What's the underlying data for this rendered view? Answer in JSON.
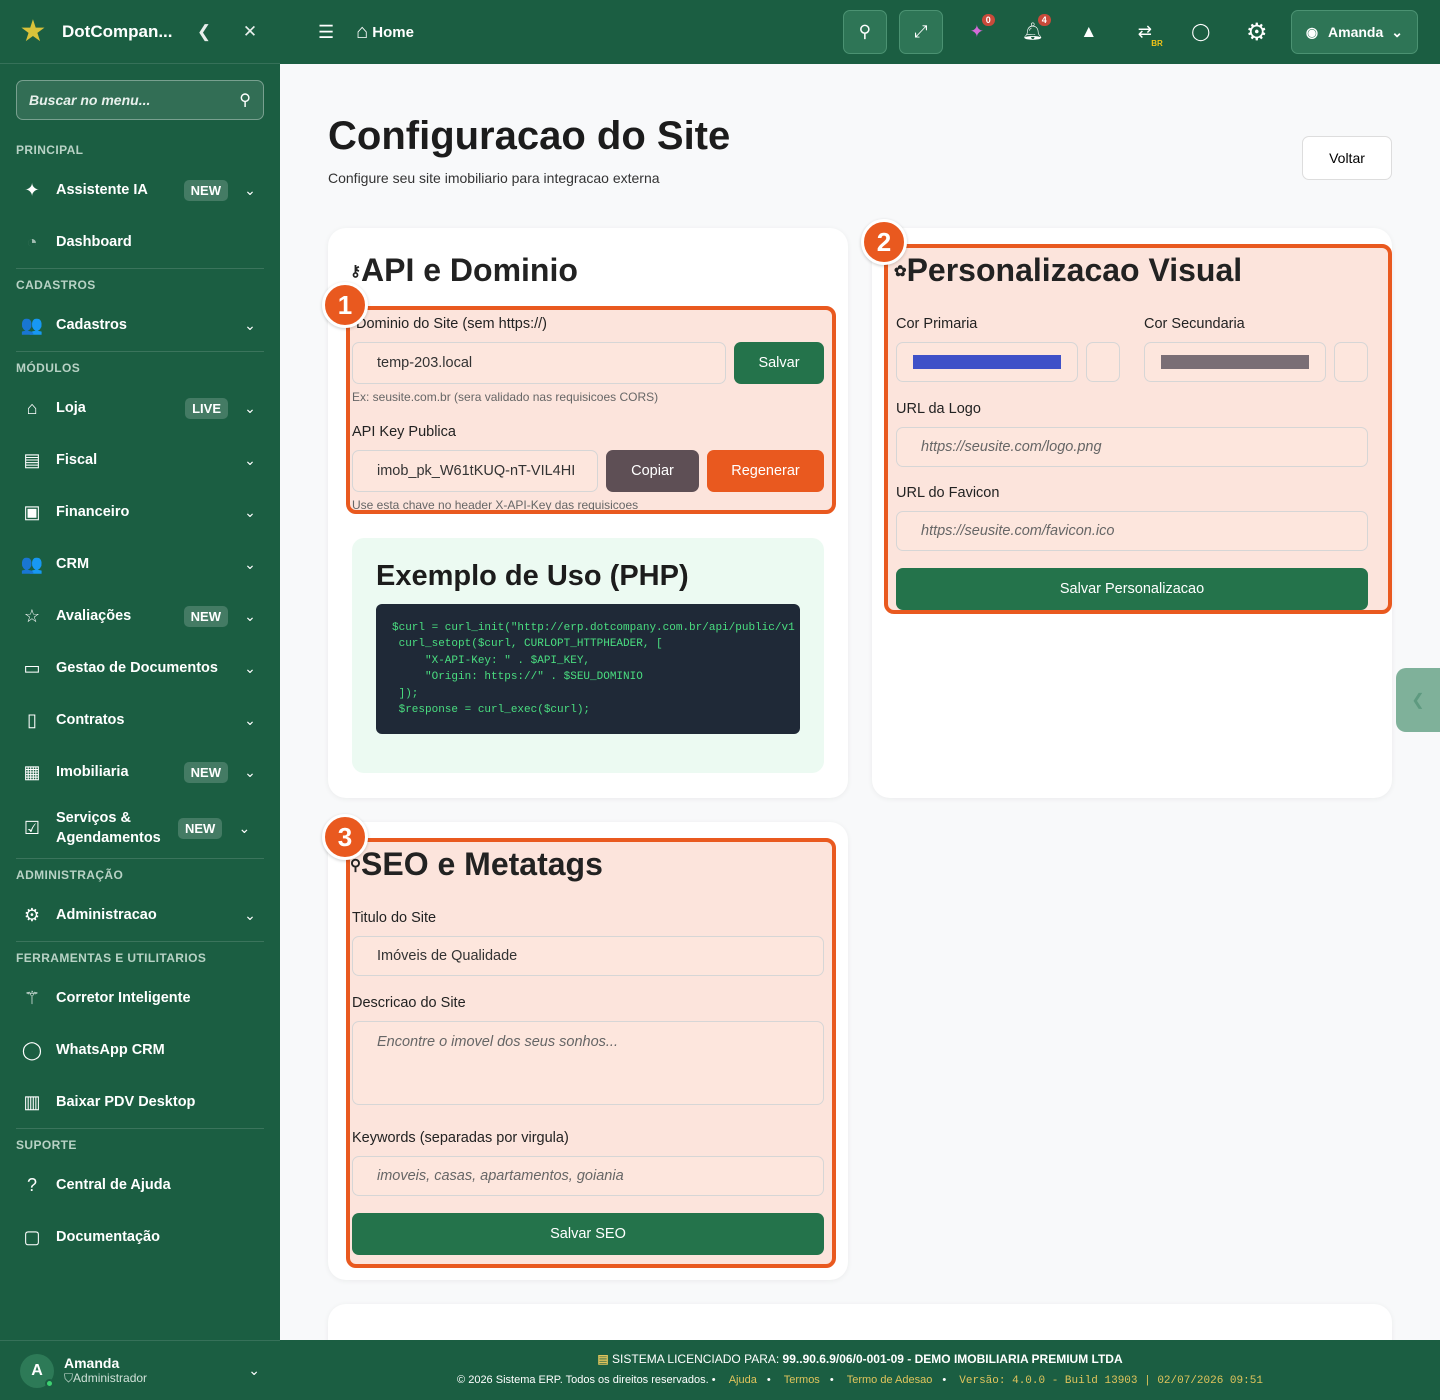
{
  "sidebar": {
    "brand": "DotCompan...",
    "collapse_icon": "chevron-left-icon",
    "close_icon": "close-icon",
    "search_placeholder": "Buscar no menu...",
    "sections": {
      "principal": "PRINCIPAL",
      "cadastros": "CADASTROS",
      "modulos": "MÓDULOS",
      "administracao": "ADMINISTRAÇÃO",
      "ferramentas": "FERRAMENTAS E UTILITARIOS",
      "suporte": "SUPORTE"
    },
    "items": {
      "assistente": {
        "label": "Assistente IA",
        "badge": "NEW"
      },
      "dashboard": {
        "label": "Dashboard"
      },
      "cadastros": {
        "label": "Cadastros"
      },
      "loja": {
        "label": "Loja",
        "badge": "LIVE"
      },
      "fiscal": {
        "label": "Fiscal"
      },
      "financeiro": {
        "label": "Financeiro"
      },
      "crm": {
        "label": "CRM"
      },
      "avaliacoes": {
        "label": "Avaliações",
        "badge": "NEW"
      },
      "documentos": {
        "label": "Gestao de Documentos"
      },
      "contratos": {
        "label": "Contratos"
      },
      "imobiliaria": {
        "label": "Imobiliaria",
        "badge": "NEW"
      },
      "servicos": {
        "label": "Serviços & Agendamentos",
        "badge": "NEW"
      },
      "administracao": {
        "label": "Administracao"
      },
      "corretor": {
        "label": "Corretor Inteligente"
      },
      "whatsapp": {
        "label": "WhatsApp CRM"
      },
      "pdv": {
        "label": "Baixar PDV Desktop"
      },
      "ajuda": {
        "label": "Central de Ajuda"
      },
      "documentacao": {
        "label": "Documentação"
      }
    },
    "user": {
      "initial": "A",
      "name": "Amanda",
      "role": "Administrador"
    }
  },
  "topbar": {
    "home_label": "Home",
    "ai_count": "0",
    "notif_count": "4",
    "lang_badge": "BR",
    "user_name": "Amanda"
  },
  "page": {
    "title": "Configuracao do Site",
    "subtitle": "Configure seu site imobiliario para integracao externa",
    "back_label": "Voltar"
  },
  "api_card": {
    "title": "API e Dominio",
    "domain_label": "Dominio do Site (sem https://)",
    "domain_value": "temp-203.local",
    "save_label": "Salvar",
    "domain_hint": "Ex: seusite.com.br (sera validado nas requisicoes CORS)",
    "key_label": "API Key Publica",
    "key_value": "imob_pk_W61tKUQ-nT-VIL4HI",
    "copy_label": "Copiar",
    "regen_label": "Regenerar",
    "key_hint": "Use esta chave no header X-API-Key das requisicoes",
    "example_title": "Exemplo de Uso (PHP)",
    "code": "$curl = curl_init(\"http://erp.dotcompany.com.br/api/public/v1\n curl_setopt($curl, CURLOPT_HTTPHEADER, [\n     \"X-API-Key: \" . $API_KEY,\n     \"Origin: https://\" . $SEU_DOMINIO\n ]);\n $response = curl_exec($curl);"
  },
  "visual_card": {
    "title": "Personalizacao Visual",
    "primary_label": "Cor Primaria",
    "secondary_label": "Cor Secundaria",
    "primary_color": "#3f51c8",
    "secondary_color": "#7a6e75",
    "logo_label": "URL da Logo",
    "logo_placeholder": "https://seusite.com/logo.png",
    "favicon_label": "URL do Favicon",
    "favicon_placeholder": "https://seusite.com/favicon.ico",
    "save_label": "Salvar Personalizacao"
  },
  "seo_card": {
    "title": "SEO e Metatags",
    "site_title_label": "Titulo do Site",
    "site_title_value": "Imóveis de Qualidade",
    "desc_label": "Descricao do Site",
    "desc_placeholder": "Encontre o imovel dos seus sonhos...",
    "keywords_label": "Keywords (separadas por virgula)",
    "keywords_placeholder": "imoveis, casas, apartamentos, goiania",
    "save_label": "Salvar SEO"
  },
  "markers": {
    "m1": "1",
    "m2": "2",
    "m3": "3"
  },
  "footer": {
    "license_prefix": "SISTEMA LICENCIADO PARA:",
    "license_value": "99..90.6.9/06/0-001-09 - DEMO IMOBILIARIA PREMIUM LTDA",
    "copyright": "© 2026 Sistema ERP. Todos os direitos reservados.",
    "help": "Ajuda",
    "terms": "Termos",
    "adhesion": "Termo de Adesao",
    "version": "Versão: 4.0.0 - Build 13903 | 02/07/2026 09:51"
  }
}
